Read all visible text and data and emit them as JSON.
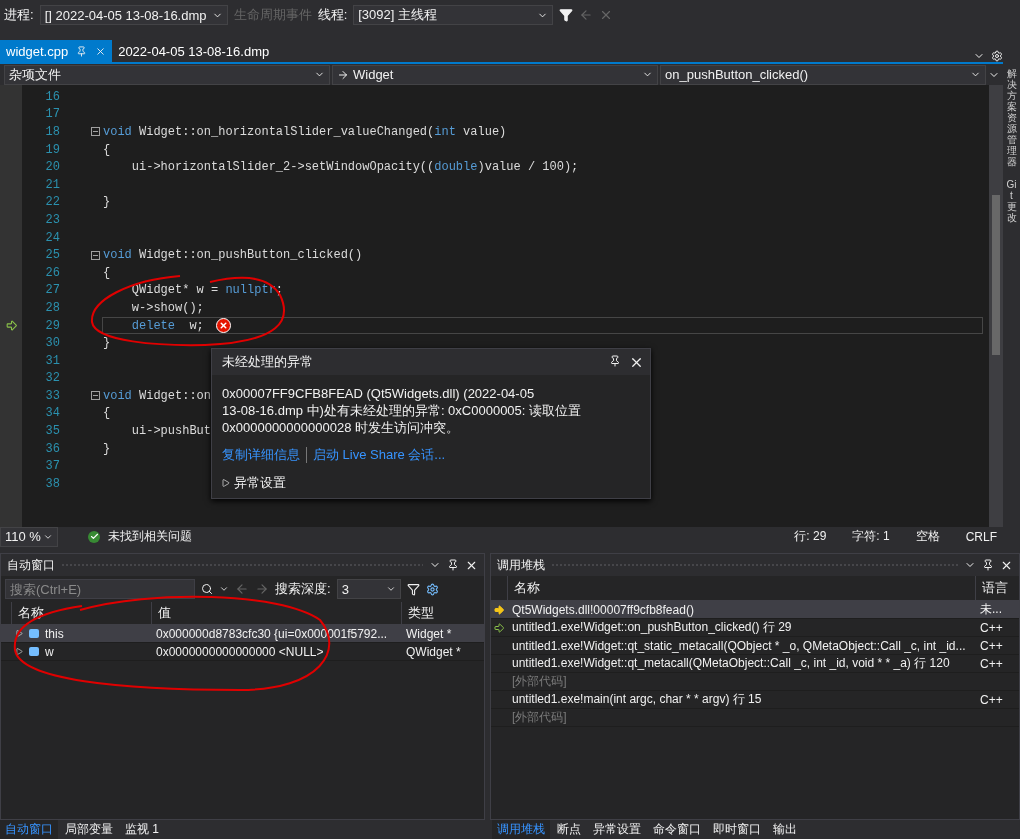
{
  "toolbar": {
    "process_label": "进程:",
    "process": "[] 2022-04-05 13-08-16.dmp",
    "lifecycle": "生命周期事件",
    "thread_label": "线程:",
    "thread": "[3092] 主线程"
  },
  "doc_tabs": [
    {
      "label": "widget.cpp",
      "selected": true
    },
    {
      "label": "2022-04-05 13-08-16.dmp",
      "selected": false
    }
  ],
  "nav": {
    "project": "杂项文件",
    "scope": "Widget",
    "member": "on_pushButton_clicked()"
  },
  "editor": {
    "lines": [
      {
        "number": "16",
        "fold": false,
        "current": false
      },
      {
        "number": "17",
        "fold": false,
        "current": false
      },
      {
        "number": "18",
        "fold": true,
        "current": false,
        "tokens": [
          {
            "text": "void",
            "kind": "keyword"
          },
          {
            "text": " Widget::on_horizontalSlider_valueChanged(",
            "kind": "plain"
          },
          {
            "text": "int",
            "kind": "keyword"
          },
          {
            "text": " value)",
            "kind": "plain"
          }
        ]
      },
      {
        "number": "19",
        "fold": false,
        "current": false,
        "tokens": [
          {
            "text": "{",
            "kind": "plain"
          }
        ]
      },
      {
        "number": "20",
        "fold": false,
        "current": false,
        "tokens": [
          {
            "text": "    ui->horizontalSlider_2->setWindowOpacity((",
            "kind": "plain"
          },
          {
            "text": "double",
            "kind": "keyword"
          },
          {
            "text": ")value / 100);",
            "kind": "plain"
          }
        ]
      },
      {
        "number": "21",
        "fold": false,
        "current": false
      },
      {
        "number": "22",
        "fold": false,
        "current": false,
        "tokens": [
          {
            "text": "}",
            "kind": "plain"
          }
        ]
      },
      {
        "number": "23",
        "fold": false,
        "current": false
      },
      {
        "number": "24",
        "fold": false,
        "current": false
      },
      {
        "number": "25",
        "fold": true,
        "current": false,
        "tokens": [
          {
            "text": "void",
            "kind": "keyword"
          },
          {
            "text": " Widget::on_pushButton_clicked()",
            "kind": "plain"
          }
        ]
      },
      {
        "number": "26",
        "fold": false,
        "current": false,
        "tokens": [
          {
            "text": "{",
            "kind": "plain"
          }
        ]
      },
      {
        "number": "27",
        "fold": false,
        "current": false,
        "tokens": [
          {
            "text": "    QWidget* w = ",
            "kind": "plain"
          },
          {
            "text": "nullptr",
            "kind": "keyword"
          },
          {
            "text": ";",
            "kind": "plain"
          }
        ]
      },
      {
        "number": "28",
        "fold": false,
        "current": false,
        "tokens": [
          {
            "text": "    w->show();",
            "kind": "plain"
          }
        ]
      },
      {
        "number": "29",
        "fold": false,
        "current": true,
        "tokens": [
          {
            "text": "    delete",
            "kind": "keyword"
          },
          {
            "text": "  w;",
            "kind": "plain"
          }
        ]
      },
      {
        "number": "30",
        "fold": false,
        "current": false,
        "tokens": [
          {
            "text": "}",
            "kind": "plain"
          }
        ]
      },
      {
        "number": "31",
        "fold": false,
        "current": false
      },
      {
        "number": "32",
        "fold": false,
        "current": false
      },
      {
        "number": "33",
        "fold": true,
        "current": false,
        "tokens": [
          {
            "text": "void",
            "kind": "keyword"
          },
          {
            "text": " Widget::on",
            "kind": "plain"
          }
        ]
      },
      {
        "number": "34",
        "fold": false,
        "current": false,
        "tokens": [
          {
            "text": "{",
            "kind": "plain"
          }
        ]
      },
      {
        "number": "35",
        "fold": false,
        "current": false,
        "tokens": [
          {
            "text": "    ui->pushBut",
            "kind": "plain"
          }
        ]
      },
      {
        "number": "36",
        "fold": false,
        "current": false,
        "tokens": [
          {
            "text": "}",
            "kind": "plain"
          }
        ]
      },
      {
        "number": "37",
        "fold": false,
        "current": false
      },
      {
        "number": "38",
        "fold": false,
        "current": false
      }
    ]
  },
  "exception": {
    "title": "未经处理的异常",
    "message": "0x00007FF9CFB8FEAD (Qt5Widgets.dll) (2022-04-05\n13-08-16.dmp 中)处有未经处理的异常: 0xC0000005: 读取位置\n0x0000000000000028 时发生访问冲突。",
    "links": [
      "复制详细信息",
      "启动 Live Share 会话..."
    ],
    "settings": "异常设置",
    "expanded": false
  },
  "editor_status": {
    "zoom": "110 %",
    "issues": "未找到相关问题",
    "line": "行: 29",
    "char": "字符: 1",
    "indent": "空格",
    "eol": "CRLF"
  },
  "side_strip": [
    "解决方案资源管理器",
    "Git 更改"
  ],
  "autos": {
    "title": "自动窗口",
    "search": {
      "placeholder": "搜索(Ctrl+E)"
    },
    "depth_label": "搜索深度:",
    "depth": "3",
    "columns": [
      "名称",
      "值",
      "类型"
    ],
    "rows": [
      {
        "name": "this",
        "value": "0x000000d8783cfc30 {ui=0x000001f5792...",
        "type": "Widget *",
        "selected": true
      },
      {
        "name": "w",
        "value": "0x0000000000000000 <NULL>",
        "type": "QWidget *",
        "selected": false
      }
    ]
  },
  "call_stack": {
    "title": "调用堆栈",
    "columns": [
      "名称",
      "语言"
    ],
    "rows": [
      {
        "kind": "current",
        "name": "Qt5Widgets.dll!00007ff9cfb8fead()",
        "language": "未...",
        "selected": true
      },
      {
        "kind": "return",
        "name": "untitled1.exe!Widget::on_pushButton_clicked() 行 29",
        "language": "C++",
        "selected": false
      },
      {
        "kind": "frame",
        "name": "untitled1.exe!Widget::qt_static_metacall(QObject * _o, QMetaObject::Call _c, int _id...",
        "language": "C++",
        "selected": false
      },
      {
        "kind": "frame",
        "name": "untitled1.exe!Widget::qt_metacall(QMetaObject::Call _c, int _id, void * * _a) 行 120",
        "language": "C++",
        "selected": false
      },
      {
        "kind": "external",
        "name": "[外部代码]",
        "selected": false
      },
      {
        "kind": "frame",
        "name": "untitled1.exe!main(int argc, char * * argv) 行 15",
        "language": "C++",
        "selected": false
      },
      {
        "kind": "external",
        "name": "[外部代码]",
        "selected": false
      }
    ]
  },
  "bottom_tabs_left": [
    {
      "label": "自动窗口",
      "selected": true
    },
    {
      "label": "局部变量",
      "selected": false
    },
    {
      "label": "监视 1",
      "selected": false
    }
  ],
  "bottom_tabs_right": [
    {
      "label": "调用堆栈",
      "selected": true
    },
    {
      "label": "断点",
      "selected": false
    },
    {
      "label": "异常设置",
      "selected": false
    },
    {
      "label": "命令窗口",
      "selected": false
    },
    {
      "label": "即时窗口",
      "selected": false
    },
    {
      "label": "输出",
      "selected": false
    }
  ]
}
